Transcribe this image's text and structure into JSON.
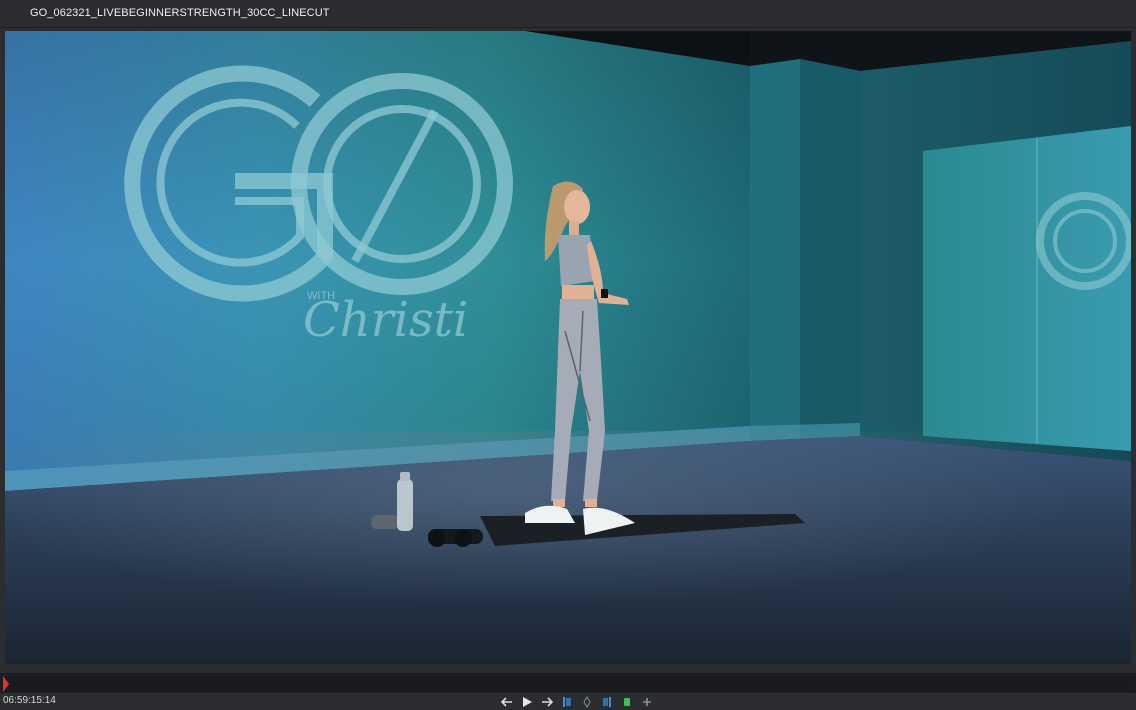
{
  "window": {
    "title": "GO_062321_LIVEBEGINNERSTRENGTH_30CC_LINECUT"
  },
  "video": {
    "logo_text": "GO",
    "logo_sub_with": "WITH",
    "logo_signature": "Christi"
  },
  "player": {
    "timecode": "06:59:15:14",
    "playhead_position": 0.0
  },
  "transport": {
    "buttons": [
      {
        "name": "step-back-button",
        "icon": "arrow-left-icon"
      },
      {
        "name": "play-button",
        "icon": "play-icon"
      },
      {
        "name": "step-forward-button",
        "icon": "arrow-right-icon"
      },
      {
        "name": "mark-in-button",
        "icon": "mark-in-icon"
      },
      {
        "name": "marker-button",
        "icon": "diamond-icon"
      },
      {
        "name": "mark-out-button",
        "icon": "mark-out-icon"
      },
      {
        "name": "clip-button",
        "icon": "green-clip-icon"
      },
      {
        "name": "add-button",
        "icon": "plus-icon"
      }
    ]
  },
  "colors": {
    "accent_red": "#e03030",
    "mark_blue": "#3a8fd8",
    "clip_green": "#3fbf5a"
  }
}
